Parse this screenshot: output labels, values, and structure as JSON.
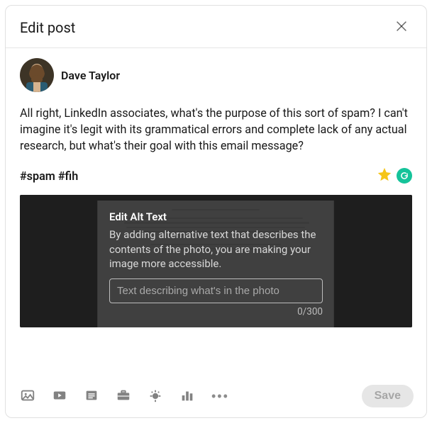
{
  "header": {
    "title": "Edit post"
  },
  "author": {
    "name": "Dave Taylor"
  },
  "post": {
    "body": "All right, LinkedIn associates, what's the purpose of this sort of spam? I can't imagine it's legit with its grammatical errors and complete lack of any actual research, but what's their goal with this email message?",
    "hashtags": "#spam #fih"
  },
  "alt_overlay": {
    "title": "Edit Alt Text",
    "description": "By adding alternative text that describes the contents of the photo, you are making your image more accessible.",
    "placeholder": "Text describing what's in the photo",
    "counter": "0/300"
  },
  "footer": {
    "save_label": "Save"
  },
  "icons": {
    "close": "close-icon",
    "star": "star-icon",
    "grammarly": "grammarly-badge",
    "photo": "photo-icon",
    "video": "video-icon",
    "document": "document-icon",
    "briefcase": "briefcase-icon",
    "celebrate": "celebrate-icon",
    "poll": "poll-icon",
    "more": "more-icon"
  }
}
